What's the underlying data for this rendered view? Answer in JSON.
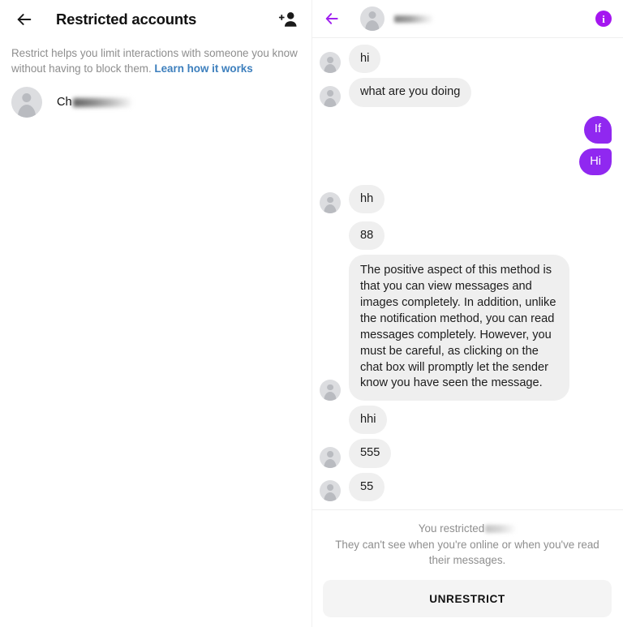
{
  "left_panel": {
    "back_icon": "back-arrow-icon",
    "title": "Restricted accounts",
    "add_icon": "add-person-icon",
    "description_text": "Restrict helps you limit interactions with someone you know without having to block them.",
    "learn_link": "Learn how it works",
    "restricted_account": {
      "avatar_icon": "default-avatar-icon",
      "name_visible": "Ch",
      "name_redacted": true
    }
  },
  "right_panel": {
    "header": {
      "back_icon": "back-arrow-icon",
      "avatar_icon": "default-avatar-icon",
      "peer_name_redacted": true,
      "info_icon": "info-icon",
      "info_glyph": "i"
    },
    "messages": [
      {
        "id": "m1",
        "direction": "in",
        "text": "hi",
        "show_avatar": true
      },
      {
        "id": "m2",
        "direction": "in",
        "text": "what are you doing",
        "show_avatar": true
      },
      {
        "id": "m3",
        "direction": "out",
        "text": "If",
        "group": "first"
      },
      {
        "id": "m4",
        "direction": "out",
        "text": "Hi",
        "group": "last"
      },
      {
        "id": "m5",
        "direction": "in",
        "text": "hh",
        "show_avatar": true
      },
      {
        "id": "m6",
        "direction": "in",
        "text": "88",
        "show_avatar": false
      },
      {
        "id": "m7",
        "direction": "in",
        "text": "The positive aspect of this method is that you can view messages and images completely. In addition, unlike the notification method, you can read messages completely. However, you must be careful, as clicking on the chat box will promptly let the sender know you have seen the message.",
        "show_avatar": true,
        "long": true
      },
      {
        "id": "m8",
        "direction": "in",
        "text": "hhi",
        "show_avatar": false
      },
      {
        "id": "m9",
        "direction": "in",
        "text": "555",
        "show_avatar": true
      },
      {
        "id": "m10",
        "direction": "in",
        "text": "55",
        "show_avatar": true
      }
    ],
    "footer": {
      "restricted_prefix": "You restricted",
      "restricted_name_redacted": true,
      "restricted_sub": "They can't see when you're online or when you've read their messages.",
      "unrestrict_label": "UNRESTRICT"
    }
  },
  "colors": {
    "accent_purple": "#9028f0",
    "info_purple": "#a516f0",
    "link_blue": "#3d7fbd",
    "bubble_gray": "#efefef",
    "muted_text": "#8e8e8e",
    "button_gray": "#f4f4f4"
  }
}
